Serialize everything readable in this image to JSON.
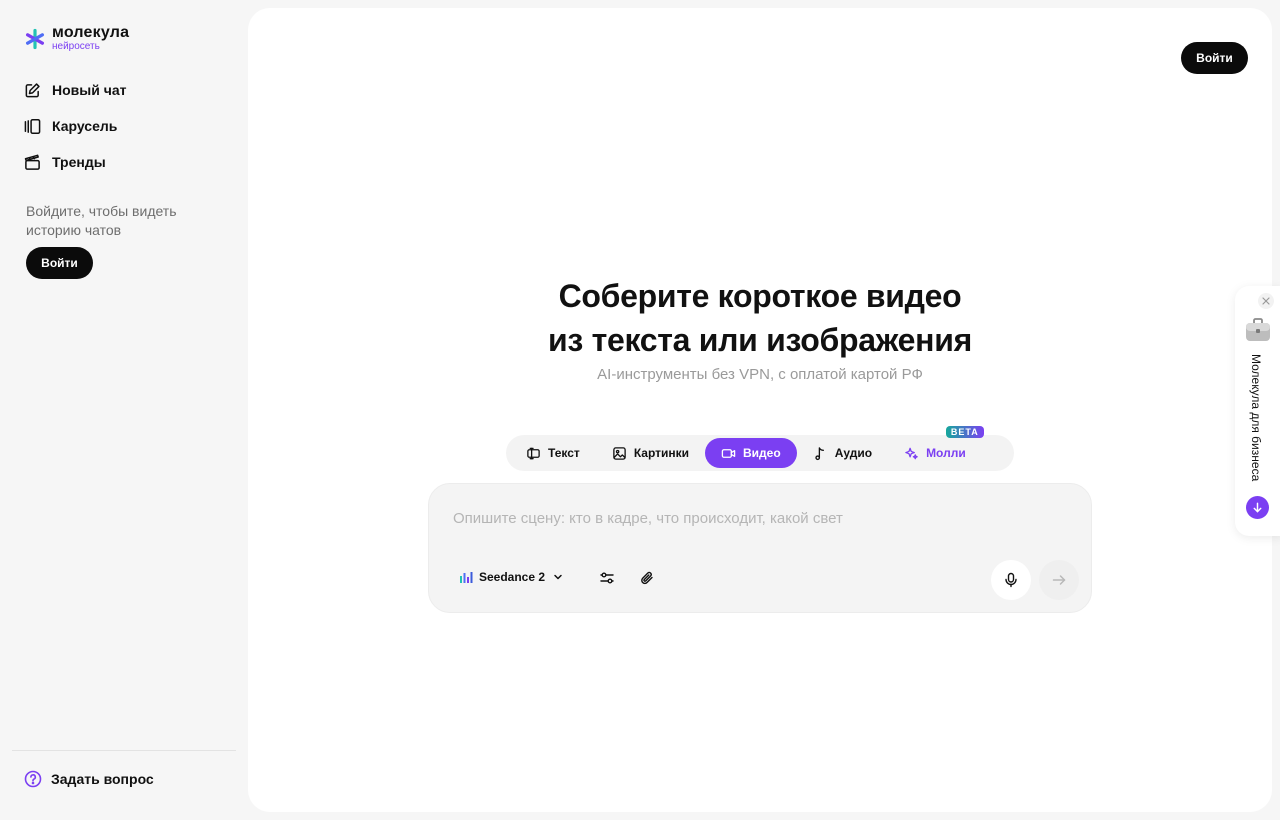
{
  "brand": {
    "name": "молекула",
    "sub": "нейросеть",
    "accent": "#7b3ff2"
  },
  "sidebar": {
    "items": [
      {
        "label": "Новый чат",
        "icon": "edit-icon"
      },
      {
        "label": "Карусель",
        "icon": "carousel-icon"
      },
      {
        "label": "Тренды",
        "icon": "clapperboard-icon"
      }
    ],
    "login_hint": "Войдите, чтобы видеть историю чатов",
    "login_label": "Войти",
    "help_label": "Задать вопрос"
  },
  "header": {
    "login_label": "Войти"
  },
  "hero": {
    "title_line1": "Соберите короткое видео",
    "title_line2": "из текста или изображения",
    "subtitle": "AI-инструменты без VPN, с оплатой картой РФ"
  },
  "tabs": [
    {
      "label": "Текст",
      "icon": "text-icon"
    },
    {
      "label": "Картинки",
      "icon": "image-icon"
    },
    {
      "label": "Видео",
      "icon": "video-icon",
      "active": true
    },
    {
      "label": "Аудио",
      "icon": "music-note-icon"
    },
    {
      "label": "Молли",
      "icon": "sparkle-icon",
      "badge": "BETA"
    }
  ],
  "composer": {
    "placeholder": "Опишите сцену: кто в кадре, что происходит, какой свет",
    "value": "",
    "model_label": "Seedance 2"
  },
  "business_widget": {
    "label": "Молекула для бизнеса"
  }
}
